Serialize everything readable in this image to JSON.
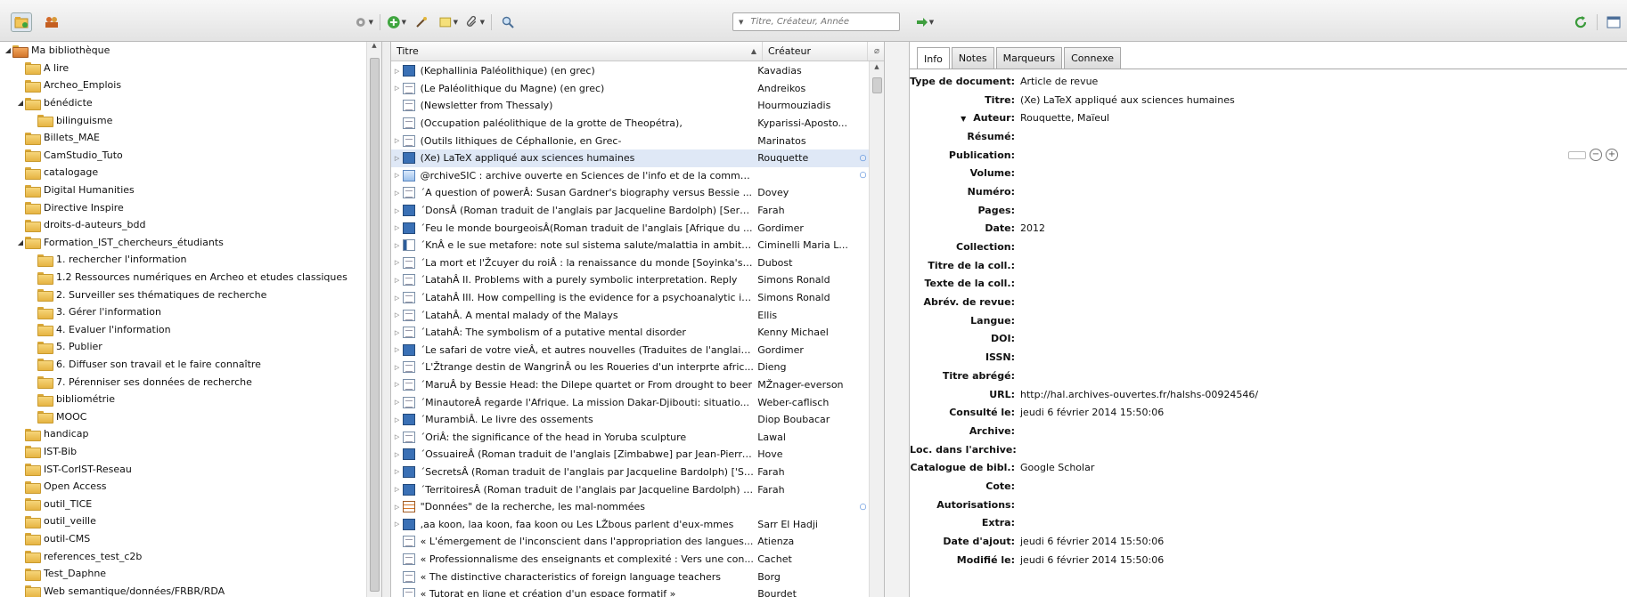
{
  "toolbar": {
    "search_placeholder": "Titre, Créateur, Année"
  },
  "columns": {
    "title": "Titre",
    "creator": "Créateur"
  },
  "library": {
    "root": "Ma bibliothèque",
    "items": [
      {
        "label": "A lire",
        "level": 1
      },
      {
        "label": "Archeo_Emplois",
        "level": 1
      },
      {
        "label": "bénédicte",
        "level": 1,
        "expanded": true
      },
      {
        "label": "bilinguisme",
        "level": 2
      },
      {
        "label": "Billets_MAE",
        "level": 1
      },
      {
        "label": "CamStudio_Tuto",
        "level": 1
      },
      {
        "label": "catalogage",
        "level": 1
      },
      {
        "label": "Digital Humanities",
        "level": 1
      },
      {
        "label": "Directive Inspire",
        "level": 1
      },
      {
        "label": "droits-d-auteurs_bdd",
        "level": 1
      },
      {
        "label": "Formation_IST_chercheurs_étudiants",
        "level": 1,
        "expanded": true
      },
      {
        "label": "1. rechercher l'information",
        "level": 2
      },
      {
        "label": "1.2 Ressources numériques en Archeo et etudes classiques",
        "level": 2
      },
      {
        "label": "2. Surveiller ses thématiques de recherche",
        "level": 2
      },
      {
        "label": "3. Gérer l'information",
        "level": 2
      },
      {
        "label": "4. Evaluer l'information",
        "level": 2
      },
      {
        "label": "5. Publier",
        "level": 2
      },
      {
        "label": "6. Diffuser son travail et le faire connaître",
        "level": 2
      },
      {
        "label": "7. Pérenniser ses données de recherche",
        "level": 2
      },
      {
        "label": "bibliométrie",
        "level": 2
      },
      {
        "label": "MOOC",
        "level": 2
      },
      {
        "label": "handicap",
        "level": 1
      },
      {
        "label": "IST-Bib",
        "level": 1
      },
      {
        "label": "IST-CorIST-Reseau",
        "level": 1
      },
      {
        "label": "Open Access",
        "level": 1
      },
      {
        "label": "outil_TICE",
        "level": 1
      },
      {
        "label": "outil_veille",
        "level": 1
      },
      {
        "label": "outil-CMS",
        "level": 1
      },
      {
        "label": "references_test_c2b",
        "level": 1
      },
      {
        "label": "Test_Daphne",
        "level": 1
      },
      {
        "label": "Web semantique/données/FRBR/RDA",
        "level": 1
      }
    ]
  },
  "items": [
    {
      "title": "(Kephallinia Paléolithique) (en grec)",
      "creator": "Kavadias",
      "icon": "journal",
      "twisty": true
    },
    {
      "title": "(Le Paléolithique du Magne) (en grec)",
      "creator": "Andreikos",
      "icon": "doc",
      "twisty": true
    },
    {
      "title": "(Newsletter from Thessaly)",
      "creator": "Hourmouziadis",
      "icon": "doc",
      "twisty": false
    },
    {
      "title": "(Occupation paléolithique de la grotte de Theopétra),",
      "creator": "Kyparissi-Aposto...",
      "icon": "doc",
      "twisty": false
    },
    {
      "title": "(Outils lithiques de Céphallonie, en Grec-",
      "creator": "Marinatos",
      "icon": "doc",
      "twisty": true
    },
    {
      "title": "(Xe) LaTeX appliqué aux sciences humaines",
      "creator": "Rouquette",
      "icon": "journal",
      "twisty": true,
      "selected": true,
      "attachment": "○"
    },
    {
      "title": "@rchiveSIC : archive ouverte en Sciences de l'info et de la commun...",
      "creator": "",
      "icon": "web",
      "twisty": true,
      "attachment": "○"
    },
    {
      "title": "´A question of powerÂ: Susan Gardner's biography versus Bessie ...",
      "creator": "Dovey",
      "icon": "doc",
      "twisty": true
    },
    {
      "title": "´DonsÂ (Roman traduit de l'anglais par Jacqueline Bardolph) [Serfi...",
      "creator": "Farah",
      "icon": "journal",
      "twisty": true
    },
    {
      "title": "´Feu le monde bourgeoisÂ(Roman traduit de l'anglais [Afrique du ...",
      "creator": "Gordimer",
      "icon": "journal",
      "twisty": true
    },
    {
      "title": "´KnÂ e le sue metafore: note sul sistema salute/malattia in ambito ´...",
      "creator": "Ciminelli Maria L...",
      "icon": "book",
      "twisty": true
    },
    {
      "title": "´La mort et l'Žcuyer du roiÂ : la renaissance du monde [Soyinka's '...",
      "creator": "Dubost",
      "icon": "doc",
      "twisty": true
    },
    {
      "title": "´LatahÂ II. Problems with a purely symbolic interpretation. Reply",
      "creator": "Simons Ronald",
      "icon": "doc",
      "twisty": true
    },
    {
      "title": "´LatahÂ III. How compelling is the evidence for a psychoanalytic in...",
      "creator": "Simons Ronald",
      "icon": "doc",
      "twisty": true
    },
    {
      "title": "´LatahÂ. A mental malady of the Malays",
      "creator": "Ellis",
      "icon": "doc",
      "twisty": true
    },
    {
      "title": "´LatahÂ: The symbolism of a putative mental disorder",
      "creator": "Kenny Michael",
      "icon": "doc",
      "twisty": true
    },
    {
      "title": "´Le safari de votre vieÂ, et autres nouvelles (Traduites de l'anglais [...",
      "creator": "Gordimer",
      "icon": "journal",
      "twisty": true
    },
    {
      "title": "´L'Žtrange destin de WangrinÂ ou les Roueries d'un interprte afric...",
      "creator": "Dieng",
      "icon": "doc",
      "twisty": true
    },
    {
      "title": "´MaruÂ by Bessie Head: the Dilepe quartet or From drought to beer",
      "creator": "MŽnager-everson",
      "icon": "doc",
      "twisty": true
    },
    {
      "title": "´MinautoreÂ regarde l'Afrique. La mission Dakar-Djibouti: situatio...",
      "creator": "Weber-caflisch",
      "icon": "doc",
      "twisty": true
    },
    {
      "title": "´MurambiÂ. Le livre des ossements",
      "creator": "Diop Boubacar",
      "icon": "journal",
      "twisty": true
    },
    {
      "title": "´OriÂ: the significance of the head in Yoruba sculpture",
      "creator": "Lawal",
      "icon": "doc",
      "twisty": true
    },
    {
      "title": "´OssuaireÂ (Roman traduit de l'anglais [Zimbabwe] par Jean-Pierre...",
      "creator": "Hove",
      "icon": "journal",
      "twisty": true
    },
    {
      "title": "´SecretsÂ (Roman traduit de l'anglais par Jacqueline Bardolph) ['Se...",
      "creator": "Farah",
      "icon": "journal",
      "twisty": true
    },
    {
      "title": "´TerritoiresÂ (Roman traduit de l'anglais par Jacqueline Bardolph) [...",
      "creator": "Farah",
      "icon": "journal",
      "twisty": true
    },
    {
      "title": "\"Données\" de la recherche, les mal-nommées",
      "creator": "",
      "icon": "data",
      "twisty": true,
      "attachment": "○"
    },
    {
      "title": ",aa koon, laa koon, faa koon ou Les LŽbous parlent d'eux-mmes",
      "creator": "Sarr El Hadji",
      "icon": "journal",
      "twisty": true
    },
    {
      "title": "« L'émergement de l'inconscient dans l'appropriation des langues...",
      "creator": "Atienza",
      "icon": "doc",
      "twisty": false
    },
    {
      "title": "« Professionnalisme des enseignants et complexité : Vers une con...",
      "creator": "Cachet",
      "icon": "doc",
      "twisty": false
    },
    {
      "title": "« The distinctive characteristics of foreign language teachers",
      "creator": "Borg",
      "icon": "doc",
      "twisty": false
    },
    {
      "title": "« Tutorat en ligne et création d'un espace formatif »",
      "creator": "Bourdet",
      "icon": "doc",
      "twisty": false
    }
  ],
  "tabs": [
    "Info",
    "Notes",
    "Marqueurs",
    "Connexe"
  ],
  "info": [
    {
      "label": "Type de document:",
      "value": "Article de revue"
    },
    {
      "label": "Titre:",
      "value": "(Xe) LaTeX appliqué aux sciences humaines"
    },
    {
      "label": "Auteur:",
      "value": "Rouquette, Maïeul",
      "creator": true
    },
    {
      "label": "Résumé:",
      "value": ""
    },
    {
      "label": "Publication:",
      "value": ""
    },
    {
      "label": "Volume:",
      "value": ""
    },
    {
      "label": "Numéro:",
      "value": ""
    },
    {
      "label": "Pages:",
      "value": ""
    },
    {
      "label": "Date:",
      "value": "2012"
    },
    {
      "label": "Collection:",
      "value": ""
    },
    {
      "label": "Titre de la coll.:",
      "value": ""
    },
    {
      "label": "Texte de la coll.:",
      "value": ""
    },
    {
      "label": "Abrév. de revue:",
      "value": ""
    },
    {
      "label": "Langue:",
      "value": ""
    },
    {
      "label": "DOI:",
      "value": ""
    },
    {
      "label": "ISSN:",
      "value": ""
    },
    {
      "label": "Titre abrégé:",
      "value": ""
    },
    {
      "label": "URL:",
      "value": "http://hal.archives-ouvertes.fr/halshs-00924546/"
    },
    {
      "label": "Consulté le:",
      "value": "jeudi 6 février 2014 15:50:06"
    },
    {
      "label": "Archive:",
      "value": ""
    },
    {
      "label": "Loc. dans l'archive:",
      "value": ""
    },
    {
      "label": "Catalogue de bibl.:",
      "value": "Google Scholar"
    },
    {
      "label": "Cote:",
      "value": ""
    },
    {
      "label": "Autorisations:",
      "value": ""
    },
    {
      "label": "Extra:",
      "value": ""
    },
    {
      "label": "Date d'ajout:",
      "value": "jeudi 6 février 2014 15:50:06"
    },
    {
      "label": "Modifié le:",
      "value": "jeudi 6 février 2014 15:50:06"
    }
  ]
}
